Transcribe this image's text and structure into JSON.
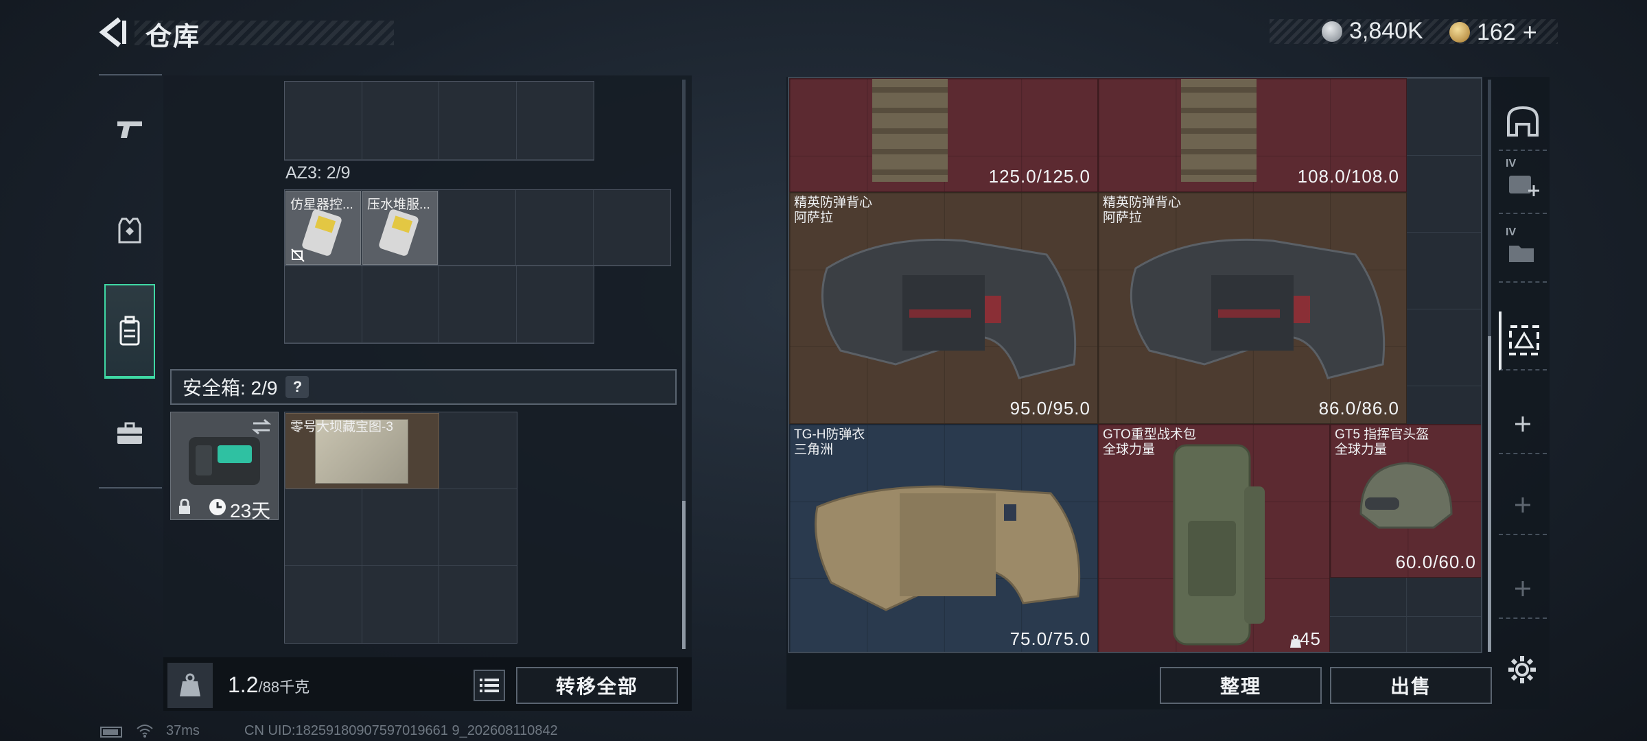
{
  "header": {
    "title": "仓库"
  },
  "currency": {
    "silver": "3,840K",
    "gold": "162",
    "gold_add": "+"
  },
  "left": {
    "az3_label": "AZ3: 2/9",
    "az3_items": [
      {
        "name": "仿星器控..."
      },
      {
        "name": "压水堆服..."
      }
    ],
    "safe_box": {
      "label": "安全箱: 2/9",
      "help": "?",
      "timer": "23天",
      "map_item": "零号大坝藏宝图-3"
    },
    "weight": {
      "value": "1.2",
      "capacity": "/88千克"
    },
    "transfer_all": "转移全部"
  },
  "stash": {
    "items": [
      {
        "id": "top-a",
        "durability": "125.0/125.0"
      },
      {
        "id": "top-b",
        "durability": "108.0/108.0"
      },
      {
        "id": "vest-1",
        "name1": "精英防弹背心",
        "name2": "阿萨拉",
        "durability": "95.0/95.0"
      },
      {
        "id": "vest-2",
        "name1": "精英防弹背心",
        "name2": "阿萨拉",
        "durability": "86.0/86.0"
      },
      {
        "id": "armor-tgh",
        "name1": "TG-H防弹衣",
        "name2": "三角洲",
        "durability": "75.0/75.0"
      },
      {
        "id": "bag-gto",
        "name1": "GTO重型战术包",
        "name2": "全球力量",
        "count": "45"
      },
      {
        "id": "helmet-gt5",
        "name1": "GT5 指挥官头盔",
        "name2": "全球力量",
        "durability": "60.0/60.0"
      }
    ],
    "sort_label": "整理",
    "sell_label": "出售",
    "side_labels": [
      "IV",
      "IV"
    ]
  },
  "status": {
    "ping": "37ms",
    "uid": "CN UID:18259180907597019661 9_202608110842"
  },
  "colors": {
    "accent": "#3fd8a4",
    "red_tier": "#5c2a31",
    "brown_tier": "#4d3c30",
    "blue_tier": "#2a3a4e"
  }
}
